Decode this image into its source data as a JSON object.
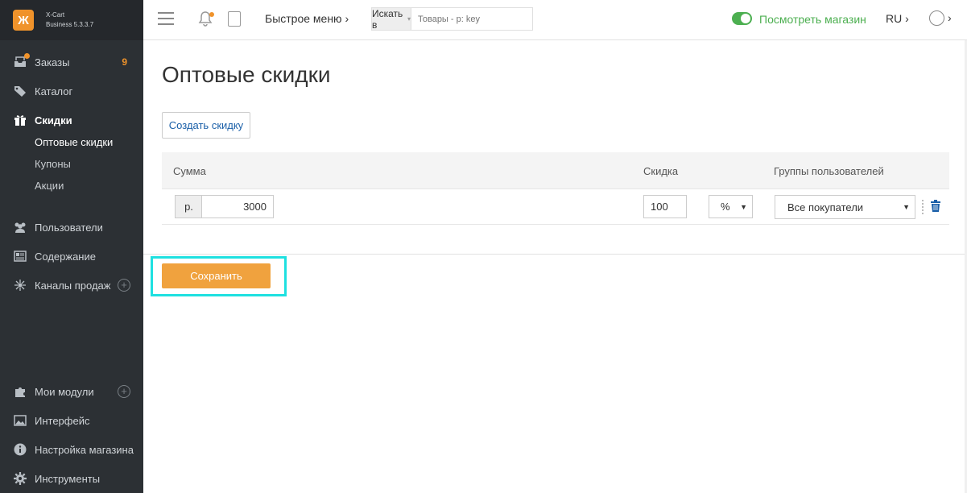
{
  "brand": {
    "logo_glyph": "Ж",
    "name": "X-Cart",
    "version": "Business 5.3.3.7",
    "accent": "#f0932b"
  },
  "sidebar": {
    "items": [
      {
        "label": "Заказы",
        "badge": "9",
        "icon": "orders-icon"
      },
      {
        "label": "Каталог",
        "icon": "tags-icon"
      },
      {
        "label": "Скидки",
        "icon": "gift-icon",
        "active": true
      },
      {
        "label": "Пользователи",
        "icon": "users-icon"
      },
      {
        "label": "Содержание",
        "icon": "content-icon"
      },
      {
        "label": "Каналы продаж",
        "icon": "sales-channels-icon"
      },
      {
        "label": "Мои модули",
        "icon": "puzzle-icon"
      },
      {
        "label": "Интерфейс",
        "icon": "image-icon"
      },
      {
        "label": "Настройка магазина",
        "icon": "info-icon"
      },
      {
        "label": "Инструменты",
        "icon": "gear-icon"
      }
    ],
    "subitems": [
      {
        "label": "Оптовые скидки",
        "active": true
      },
      {
        "label": "Купоны"
      },
      {
        "label": "Акции"
      }
    ]
  },
  "header": {
    "quick_menu": "Быстрое меню",
    "search_in": "Искать в",
    "search_placeholder": "Товары - р: key",
    "view_store": "Посмотреть магазин",
    "lang": "RU",
    "store_color": "#4caf50"
  },
  "main": {
    "title": "Оптовые скидки",
    "create_button": "Создать скидку",
    "table": {
      "headers": {
        "amount": "Сумма",
        "discount": "Скидка",
        "groups": "Группы пользователей"
      },
      "rows": [
        {
          "currency": "р.",
          "amount": "3000",
          "discount": "100",
          "unit": "%",
          "group": "Все покупатели"
        }
      ]
    },
    "save_button": "Сохранить",
    "save_color": "#f0a23e"
  }
}
